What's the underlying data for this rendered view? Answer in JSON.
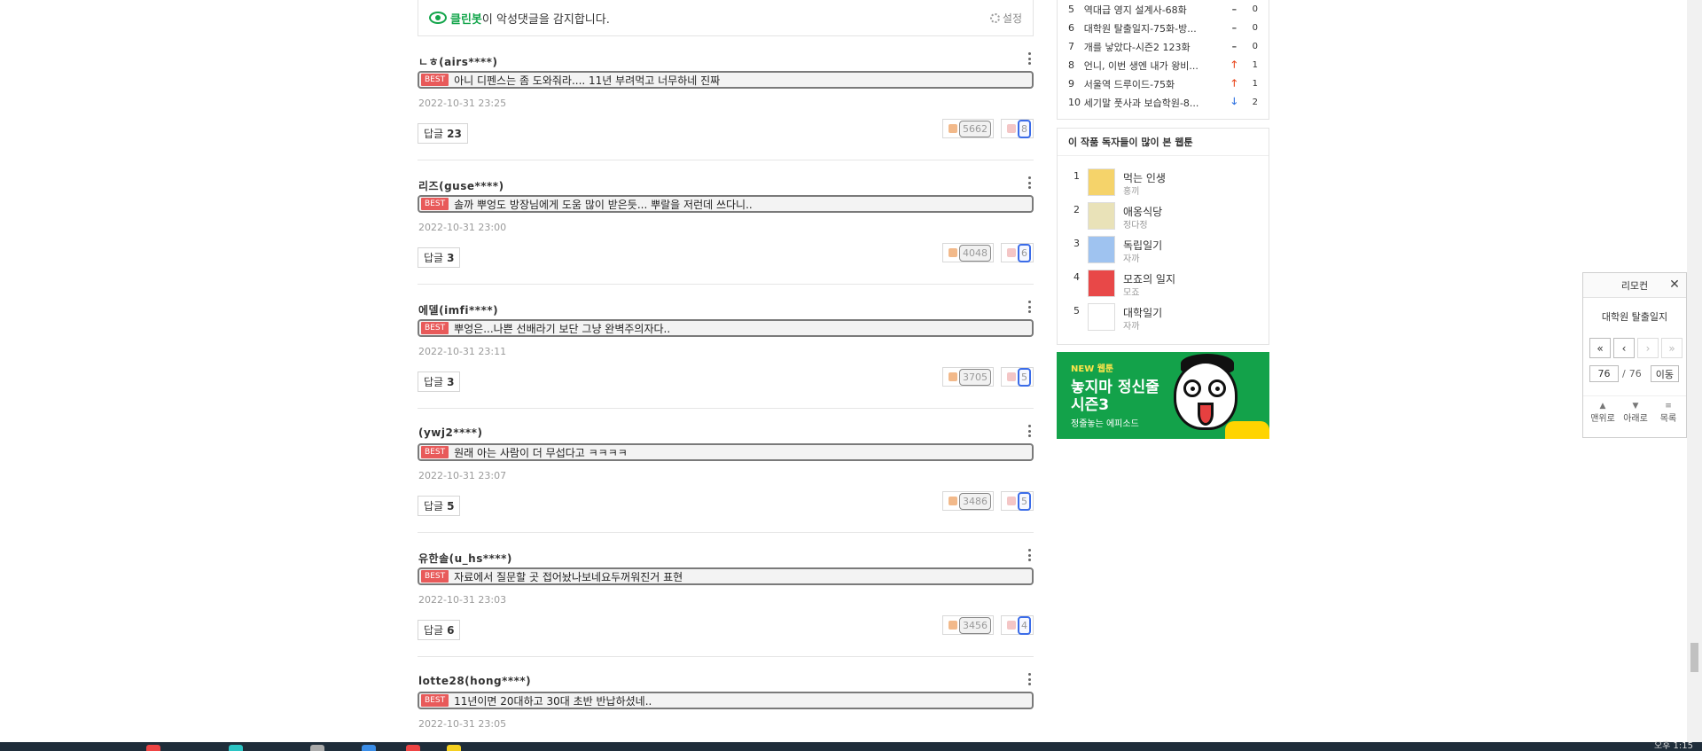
{
  "cleanbot": {
    "brand": "클린봇",
    "message": "이 악성댓글을 감지합니다.",
    "settings_label": "설정"
  },
  "best_label": "BEST",
  "reply_label": "답글",
  "comments": [
    {
      "author": "ㄴㅎ(airs****)",
      "text": "아니 디펜스는 좀 도와줘라.... 11년 부려먹고 너무하네 진짜",
      "date": "2022-10-31 23:25",
      "replies": "23",
      "likes": "5662",
      "dislikes": "8"
    },
    {
      "author": "리즈(guse****)",
      "text": "솔까 뿌엉도 방장님에게 도움 많이 받은듯... 뿌랄을 저런데 쓰다니..",
      "date": "2022-10-31 23:00",
      "replies": "3",
      "likes": "4048",
      "dislikes": "6"
    },
    {
      "author": "에델(imfi****)",
      "text": "뿌엉은...나쁜 선배라기 보단 그냥 완벽주의자다..",
      "date": "2022-10-31 23:11",
      "replies": "3",
      "likes": "3705",
      "dislikes": "5"
    },
    {
      "author": "(ywj2****)",
      "text": "원래 아는 사람이 더 무섭다고 ㅋㅋㅋㅋ",
      "date": "2022-10-31 23:07",
      "replies": "5",
      "likes": "3486",
      "dislikes": "5"
    },
    {
      "author": "유한솔(u_hs****)",
      "text": "자료에서 질문할 곳 접어놨나보네요두꺼워진거 표현",
      "date": "2022-10-31 23:03",
      "replies": "6",
      "likes": "3456",
      "dislikes": "4"
    },
    {
      "author": "lotte28(hong****)",
      "text": "11년이면 20대하고 30대 초반 반납하셨네..",
      "date": "2022-10-31 23:05",
      "replies": "",
      "likes": "",
      "dislikes": ""
    }
  ],
  "ranking": [
    {
      "rank": "5",
      "title": "역대급 영지 설계사-68화",
      "move": "–",
      "dir": "same",
      "delta": "0"
    },
    {
      "rank": "6",
      "title": "대학원 탈출일지-75화-방...",
      "move": "–",
      "dir": "same",
      "delta": "0"
    },
    {
      "rank": "7",
      "title": "개를 낳았다-시즌2 123화",
      "move": "–",
      "dir": "same",
      "delta": "0"
    },
    {
      "rank": "8",
      "title": "언니, 이번 생엔 내가 왕비...",
      "move": "🡑",
      "dir": "up",
      "delta": "1"
    },
    {
      "rank": "9",
      "title": "서울역 드루이드-75화",
      "move": "🡑",
      "dir": "up",
      "delta": "1"
    },
    {
      "rank": "10",
      "title": "세기말 풋사과 보습학원-8...",
      "move": "🡓",
      "dir": "down",
      "delta": "2"
    }
  ],
  "readers": {
    "heading": "이 작품 독자들이 많이 본 웹툰",
    "items": [
      {
        "rank": "1",
        "title": "먹는 인생",
        "artist": "홍끼",
        "color": "#f5d36a"
      },
      {
        "rank": "2",
        "title": "애옹식당",
        "artist": "정다정",
        "color": "#e9e2b8"
      },
      {
        "rank": "3",
        "title": "독립일기",
        "artist": "자까",
        "color": "#9fc3f0"
      },
      {
        "rank": "4",
        "title": "모죠의 일지",
        "artist": "모죠",
        "color": "#e84848"
      },
      {
        "rank": "5",
        "title": "대학일기",
        "artist": "자까",
        "color": "#ffffff"
      }
    ]
  },
  "banner": {
    "new_label": "NEW 웹툰",
    "title_line1": "놓지마 정신줄",
    "title_line2": "시즌3",
    "sub": "정줄놓는 에피소드"
  },
  "remote": {
    "header": "리모컨",
    "close": "✕",
    "title": "대학원 탈출일지",
    "nav": [
      "«",
      "‹",
      "›",
      "»"
    ],
    "page_current": "76",
    "page_sep": "/",
    "page_total": "76",
    "go_label": "이동",
    "bottom": [
      {
        "icon": "▲",
        "label": "맨위로"
      },
      {
        "icon": "▼",
        "label": "아래로"
      },
      {
        "icon": "≡",
        "label": "목록"
      }
    ]
  },
  "taskbar": {
    "time": "오후 1:15"
  }
}
